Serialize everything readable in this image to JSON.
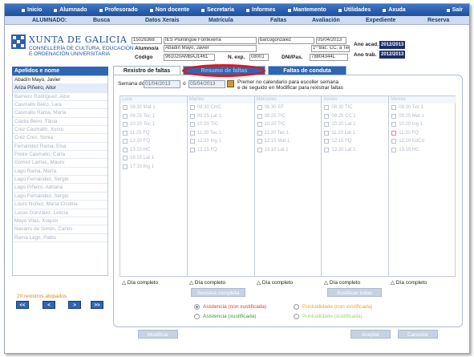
{
  "top_menu": [
    "Inicio",
    "Alumnado",
    "Profesorado",
    "Non docente",
    "Secretaría",
    "Informes",
    "Mantemento",
    "Utilidades",
    "Axuda",
    "Saír"
  ],
  "sub_menu": {
    "section": "ALUMNADO:",
    "items": [
      "Busca",
      "Datos Xerais",
      "Matrícula",
      "Faltas",
      "Avaliación",
      "Expediente",
      "Reserva"
    ]
  },
  "brand": {
    "name": "XUNTA DE GALICIA",
    "dept_line1": "CONSELLERÍA DE CULTURA, EDUCACIÓN",
    "dept_line2": "E ORDENACIÓN UNIVERSITARIA"
  },
  "header": {
    "centre_code": "15026368",
    "centre_name": "IES Plurilingüe Fontexería",
    "user": "barcogonzalez",
    "date": "05/04/2013",
    "alumno_label": "Alumno/a",
    "alumno_value": "Abadín Mayo, Javier",
    "curso": "1º Bac. CC. a Tec.-B",
    "codigo_label": "Código",
    "codigo_value": "961020AMBAJ1461",
    "nexp_label": "N. exp.",
    "nexp_value": "08001",
    "dni_label": "DNI/Pas.",
    "dni_value": "78804344L",
    "ano_acad_label": "Ano acad.",
    "ano_acad_value": "2012/2013",
    "ano_trab_label": "Ano trab.",
    "ano_trab_value": "2012/2013"
  },
  "list": {
    "header": "Apelidos e nome",
    "items": [
      "Abadín Mayo, Javier",
      "Ariza Piñeiro, Aitor",
      "Barreiro Rodríguez, Aitor",
      "Casmallo Beiro, Lara",
      "Casmallo Rama, María",
      "Ciadia Beiro, Tânia",
      "Crez Casmallo, Xurxo",
      "Crez Crez, Sonia",
      "Fernández Rama, Elsa",
      "Freire Casmallo, Carla",
      "Gómez Lamas, Mauro",
      "Lago Rama, María",
      "Lago Fernández, Sergio",
      "Lago Piñeiro, Adriana",
      "Lago Fernández, Sergio",
      "Louro Núñez, María Cristina",
      "Lucas González, Leticia",
      "Mayo Vilas, Xoquín",
      "Navarro de Simón, Carlos",
      "Rama Lago, Pablo"
    ],
    "records": "20 rexistros atopados",
    "pager": [
      "<<",
      "<",
      ">",
      ">>"
    ]
  },
  "tabs": [
    "Rexistro de faltas",
    "Resumo de faltas",
    "Faltas de conduta"
  ],
  "week": {
    "label": "Semana do",
    "from": "01/04/2013",
    "sep": "ó",
    "to": "05/04/2013",
    "note_line1": "Premer no calendario para escoller semana",
    "note_line2": "e de seguido en Modificar para rexistrar faltas"
  },
  "grid": {
    "days": [
      "Luns",
      "Martes",
      "Mércores",
      "Xoves",
      "Venres"
    ],
    "columns": [
      [
        "08:30 Mat 1",
        "09:25 Tec 1",
        "10:20 Tec 1",
        "11:25 FQ",
        "12:20 FQ",
        "13:15 HC",
        "16:15 Lat 1",
        "17:10 Ing 1"
      ],
      [
        "08:30 CmC",
        "09:25 Lat 1",
        "10:20 TIC",
        "11:20 Tec 1",
        "12:20 Ing 1",
        "13:15 FQ"
      ],
      [
        "08:30 EF",
        "09:25 TIC",
        "10:20 TIC",
        "11:20 Tec 1",
        "12:15 Mat 1",
        "13:10 Lat 1"
      ],
      [
        "08:30 TIC",
        "09:25 CC 1",
        "10:20 Lat 1",
        "11:20 Lat 1",
        "12:15 FQ",
        "13:20 Lat 1"
      ],
      [
        "08:30 Tec 1",
        "09:25 Mat 1",
        "10:20 Ing 1",
        "11:20 FQ",
        "12:20 EdCd",
        "13:15 HC"
      ]
    ],
    "dia_completo": "Día completo"
  },
  "buttons": {
    "semana_completa": "Semana completa",
    "xustificar_todas": "Xustificar todas",
    "modificar": "Modificar",
    "aceptar": "Aceptar",
    "cancelar": "Cancelar"
  },
  "legend": {
    "asist_nonx": "Asistencia (non xustificada)",
    "asist_x": "Asistencia (xustificada)",
    "punt_nonx": "Puntualidade (non xustificada)",
    "punt_x": "Puntualidade (xustificada)"
  },
  "colors": {
    "menu_blue": "#2f66b3",
    "highlight_red": "#e41616",
    "asist_nonx": "#e23b3b",
    "asist_x": "#3a9a3a",
    "punt_nonx": "#f0a030",
    "punt_x": "#9fcf6a"
  }
}
